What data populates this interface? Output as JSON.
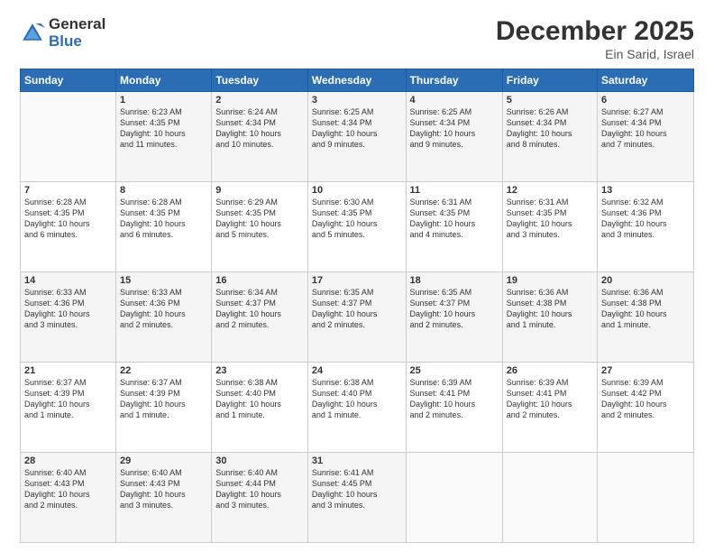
{
  "header": {
    "logo_general": "General",
    "logo_blue": "Blue",
    "month_year": "December 2025",
    "location": "Ein Sarid, Israel"
  },
  "columns": [
    "Sunday",
    "Monday",
    "Tuesday",
    "Wednesday",
    "Thursday",
    "Friday",
    "Saturday"
  ],
  "weeks": [
    [
      {
        "day": "",
        "info": ""
      },
      {
        "day": "1",
        "info": "Sunrise: 6:23 AM\nSunset: 4:35 PM\nDaylight: 10 hours\nand 11 minutes."
      },
      {
        "day": "2",
        "info": "Sunrise: 6:24 AM\nSunset: 4:34 PM\nDaylight: 10 hours\nand 10 minutes."
      },
      {
        "day": "3",
        "info": "Sunrise: 6:25 AM\nSunset: 4:34 PM\nDaylight: 10 hours\nand 9 minutes."
      },
      {
        "day": "4",
        "info": "Sunrise: 6:25 AM\nSunset: 4:34 PM\nDaylight: 10 hours\nand 9 minutes."
      },
      {
        "day": "5",
        "info": "Sunrise: 6:26 AM\nSunset: 4:34 PM\nDaylight: 10 hours\nand 8 minutes."
      },
      {
        "day": "6",
        "info": "Sunrise: 6:27 AM\nSunset: 4:34 PM\nDaylight: 10 hours\nand 7 minutes."
      }
    ],
    [
      {
        "day": "7",
        "info": "Sunrise: 6:28 AM\nSunset: 4:35 PM\nDaylight: 10 hours\nand 6 minutes."
      },
      {
        "day": "8",
        "info": "Sunrise: 6:28 AM\nSunset: 4:35 PM\nDaylight: 10 hours\nand 6 minutes."
      },
      {
        "day": "9",
        "info": "Sunrise: 6:29 AM\nSunset: 4:35 PM\nDaylight: 10 hours\nand 5 minutes."
      },
      {
        "day": "10",
        "info": "Sunrise: 6:30 AM\nSunset: 4:35 PM\nDaylight: 10 hours\nand 5 minutes."
      },
      {
        "day": "11",
        "info": "Sunrise: 6:31 AM\nSunset: 4:35 PM\nDaylight: 10 hours\nand 4 minutes."
      },
      {
        "day": "12",
        "info": "Sunrise: 6:31 AM\nSunset: 4:35 PM\nDaylight: 10 hours\nand 3 minutes."
      },
      {
        "day": "13",
        "info": "Sunrise: 6:32 AM\nSunset: 4:36 PM\nDaylight: 10 hours\nand 3 minutes."
      }
    ],
    [
      {
        "day": "14",
        "info": "Sunrise: 6:33 AM\nSunset: 4:36 PM\nDaylight: 10 hours\nand 3 minutes."
      },
      {
        "day": "15",
        "info": "Sunrise: 6:33 AM\nSunset: 4:36 PM\nDaylight: 10 hours\nand 2 minutes."
      },
      {
        "day": "16",
        "info": "Sunrise: 6:34 AM\nSunset: 4:37 PM\nDaylight: 10 hours\nand 2 minutes."
      },
      {
        "day": "17",
        "info": "Sunrise: 6:35 AM\nSunset: 4:37 PM\nDaylight: 10 hours\nand 2 minutes."
      },
      {
        "day": "18",
        "info": "Sunrise: 6:35 AM\nSunset: 4:37 PM\nDaylight: 10 hours\nand 2 minutes."
      },
      {
        "day": "19",
        "info": "Sunrise: 6:36 AM\nSunset: 4:38 PM\nDaylight: 10 hours\nand 1 minute."
      },
      {
        "day": "20",
        "info": "Sunrise: 6:36 AM\nSunset: 4:38 PM\nDaylight: 10 hours\nand 1 minute."
      }
    ],
    [
      {
        "day": "21",
        "info": "Sunrise: 6:37 AM\nSunset: 4:39 PM\nDaylight: 10 hours\nand 1 minute."
      },
      {
        "day": "22",
        "info": "Sunrise: 6:37 AM\nSunset: 4:39 PM\nDaylight: 10 hours\nand 1 minute."
      },
      {
        "day": "23",
        "info": "Sunrise: 6:38 AM\nSunset: 4:40 PM\nDaylight: 10 hours\nand 1 minute."
      },
      {
        "day": "24",
        "info": "Sunrise: 6:38 AM\nSunset: 4:40 PM\nDaylight: 10 hours\nand 1 minute."
      },
      {
        "day": "25",
        "info": "Sunrise: 6:39 AM\nSunset: 4:41 PM\nDaylight: 10 hours\nand 2 minutes."
      },
      {
        "day": "26",
        "info": "Sunrise: 6:39 AM\nSunset: 4:41 PM\nDaylight: 10 hours\nand 2 minutes."
      },
      {
        "day": "27",
        "info": "Sunrise: 6:39 AM\nSunset: 4:42 PM\nDaylight: 10 hours\nand 2 minutes."
      }
    ],
    [
      {
        "day": "28",
        "info": "Sunrise: 6:40 AM\nSunset: 4:43 PM\nDaylight: 10 hours\nand 2 minutes."
      },
      {
        "day": "29",
        "info": "Sunrise: 6:40 AM\nSunset: 4:43 PM\nDaylight: 10 hours\nand 3 minutes."
      },
      {
        "day": "30",
        "info": "Sunrise: 6:40 AM\nSunset: 4:44 PM\nDaylight: 10 hours\nand 3 minutes."
      },
      {
        "day": "31",
        "info": "Sunrise: 6:41 AM\nSunset: 4:45 PM\nDaylight: 10 hours\nand 3 minutes."
      },
      {
        "day": "",
        "info": ""
      },
      {
        "day": "",
        "info": ""
      },
      {
        "day": "",
        "info": ""
      }
    ]
  ]
}
